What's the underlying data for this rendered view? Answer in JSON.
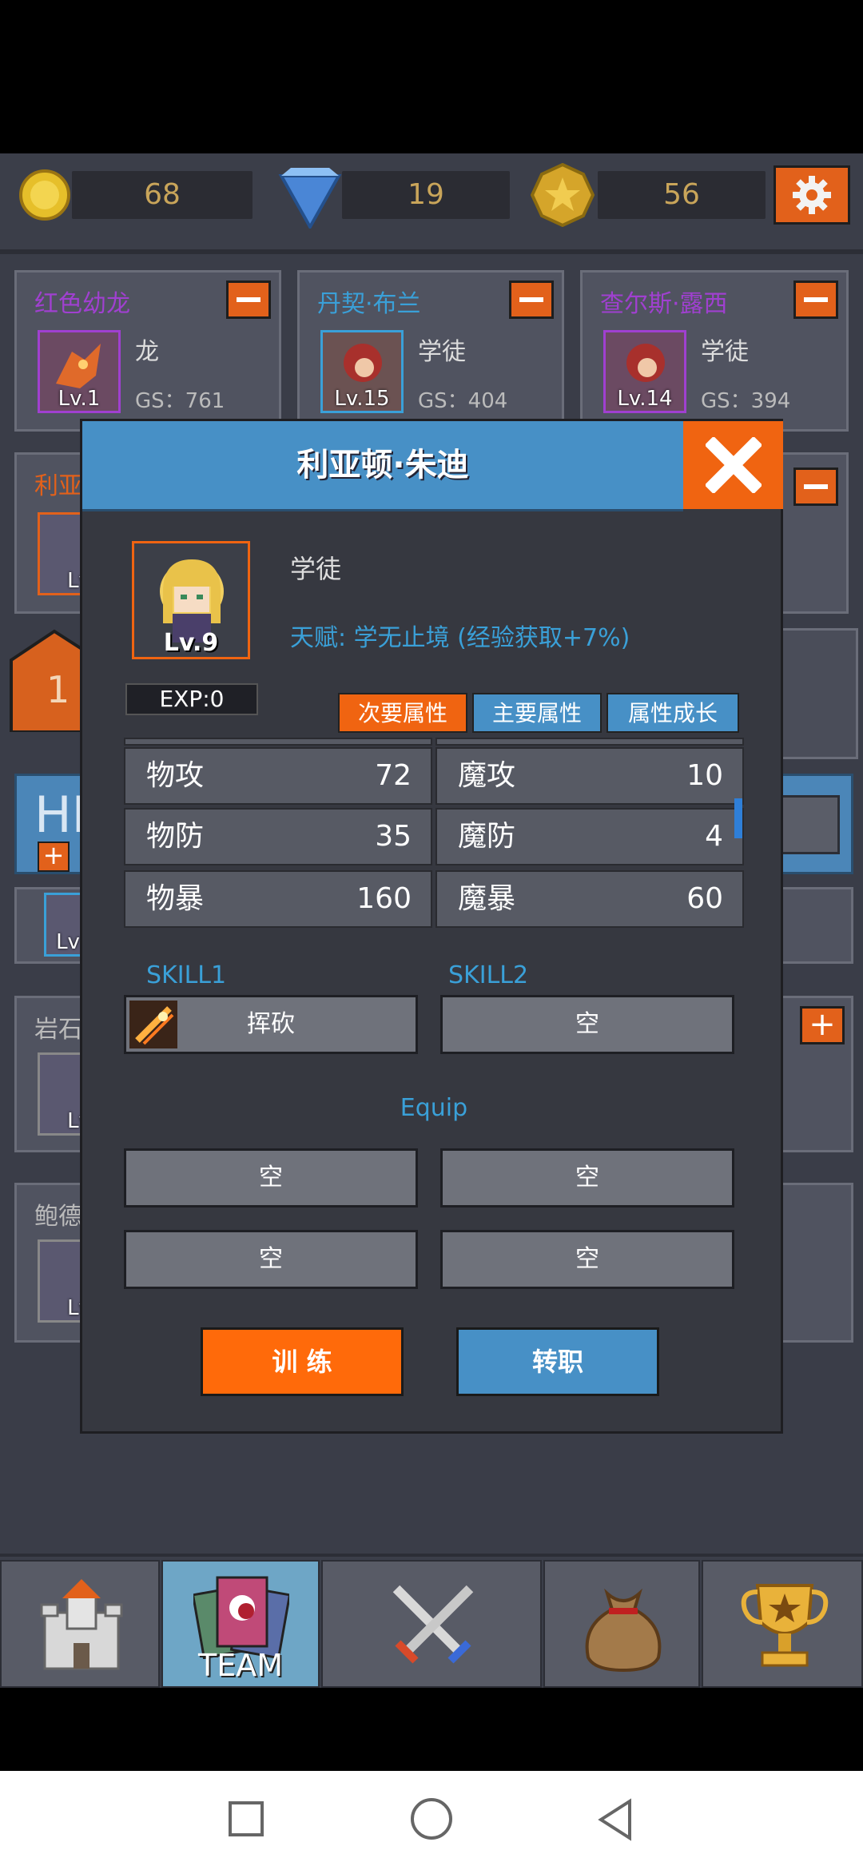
{
  "currency": {
    "gold": "68",
    "diamond": "19",
    "medal": "56"
  },
  "team": {
    "cards": [
      {
        "name": "红色幼龙",
        "class": "龙",
        "level": "Lv.1",
        "gs": "GS：761"
      },
      {
        "name": "丹契·布兰",
        "class": "学徒",
        "level": "Lv.15",
        "gs": "GS：404"
      },
      {
        "name": "查尔斯·露西",
        "class": "学徒",
        "level": "Lv.14",
        "gs": "GS：394"
      }
    ],
    "partial_names": {
      "row2": "利亚",
      "row5": "岩石",
      "row6": "鲍德"
    },
    "partial_level": "Lv",
    "tile_number": "1",
    "hp_fragment": "HI"
  },
  "modal": {
    "title": "利亚顿·朱迪",
    "class": "学徒",
    "talent": "天赋: 学无止境 (经验获取+7%)",
    "level": "Lv.9",
    "exp": "EXP:0",
    "tabs": [
      "次要属性",
      "主要属性",
      "属性成长"
    ],
    "stats": [
      {
        "name": "物攻",
        "value": "72"
      },
      {
        "name": "魔攻",
        "value": "10"
      },
      {
        "name": "物防",
        "value": "35"
      },
      {
        "name": "魔防",
        "value": "4"
      },
      {
        "name": "物暴",
        "value": "160"
      },
      {
        "name": "魔暴",
        "value": "60"
      }
    ],
    "skill1_label": "SKILL1",
    "skill2_label": "SKILL2",
    "skill1": "挥砍",
    "skill2": "空",
    "equip_label": "Equip",
    "equip": [
      "空",
      "空",
      "空",
      "空"
    ],
    "train_button": "训 练",
    "class_change_button": "转职"
  },
  "nav": {
    "team_label": "TEAM"
  },
  "colors": {
    "accent_orange": "#f06411",
    "accent_blue": "#4790c6",
    "gold_text": "#c9a55a",
    "purple_name": "#a040d0",
    "blue_name": "#3aa0d8"
  }
}
